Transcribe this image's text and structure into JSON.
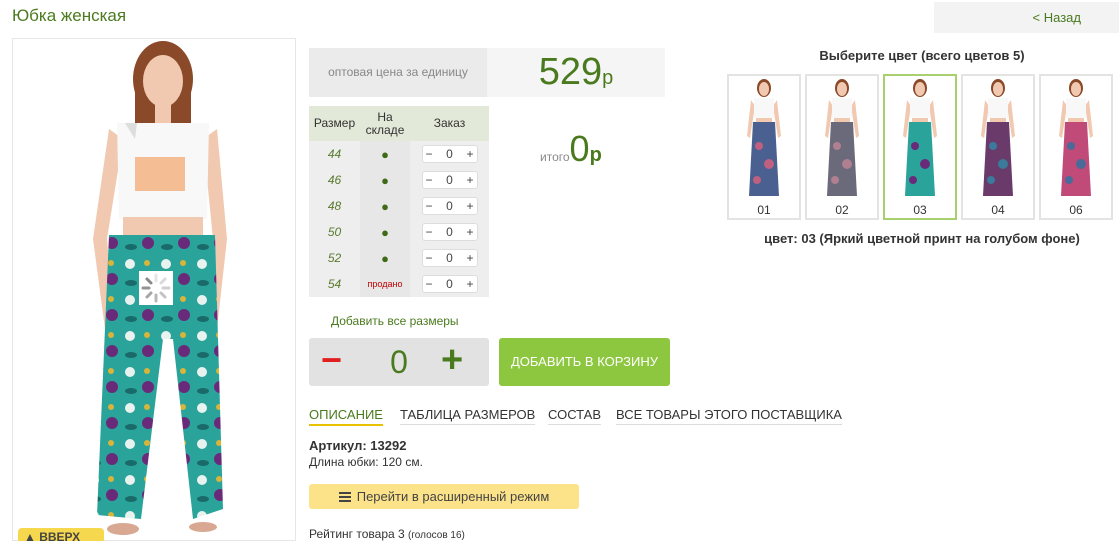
{
  "product": {
    "title": "Юбка женская",
    "back_label": "< Назад",
    "up_label": "▲ ВВЕРХ"
  },
  "price": {
    "label": "оптовая цена за единицу",
    "value": "529",
    "currency": "р"
  },
  "size_table": {
    "headers": [
      "Размер",
      "На складе",
      "Заказ"
    ],
    "rows": [
      {
        "size": "44",
        "stock": "●",
        "qty": "0"
      },
      {
        "size": "46",
        "stock": "●",
        "qty": "0"
      },
      {
        "size": "48",
        "stock": "●",
        "qty": "0"
      },
      {
        "size": "50",
        "stock": "●",
        "qty": "0"
      },
      {
        "size": "52",
        "stock": "●",
        "qty": "0"
      },
      {
        "size": "54",
        "stock": "продано",
        "qty": "0"
      }
    ],
    "minus": "−",
    "plus": "+"
  },
  "total": {
    "label": "итого",
    "value": "0",
    "currency": "р"
  },
  "order": {
    "add_all_label": "Добавить все размеры",
    "minus": "−",
    "qty": "0",
    "plus": "+",
    "cart_label": "ДОБАВИТЬ В КОРЗИНУ"
  },
  "tabs": [
    {
      "label": "ОПИСАНИЕ",
      "active": true
    },
    {
      "label": "ТАБЛИЦА РАЗМЕРОВ",
      "active": false
    },
    {
      "label": "СОСТАВ",
      "active": false
    },
    {
      "label": "ВСЕ ТОВАРЫ ЭТОГО ПОСТАВЩИКА",
      "active": false
    }
  ],
  "description": {
    "article": "Артикул: 13292",
    "length": "Длина юбки: 120 см.",
    "extended_mode_label": "Перейти в расширенный режим",
    "rating": "Рейтинг товара 3",
    "votes": "(голосов 16)"
  },
  "colors": {
    "title": "Выберите цвет (всего цветов 5)",
    "swatches": [
      {
        "label": "01",
        "color": "#4a6090",
        "accent": "#c06080"
      },
      {
        "label": "02",
        "color": "#6a6a7a",
        "accent": "#b08090"
      },
      {
        "label": "03",
        "color": "#2aa39a",
        "accent": "#6a2a7a"
      },
      {
        "label": "04",
        "color": "#6a3a6a",
        "accent": "#3a7a9a"
      },
      {
        "label": "06",
        "color": "#c04a78",
        "accent": "#4a6a9a"
      }
    ],
    "selected": "03",
    "caption": "цвет: 03 (Яркий цветной принт на голубом фоне)"
  },
  "theme": {
    "accent_green": "#4a7a1e",
    "cart_green": "#8dc63f",
    "sold_red": "#c00000",
    "yellow": "#fce38a"
  }
}
